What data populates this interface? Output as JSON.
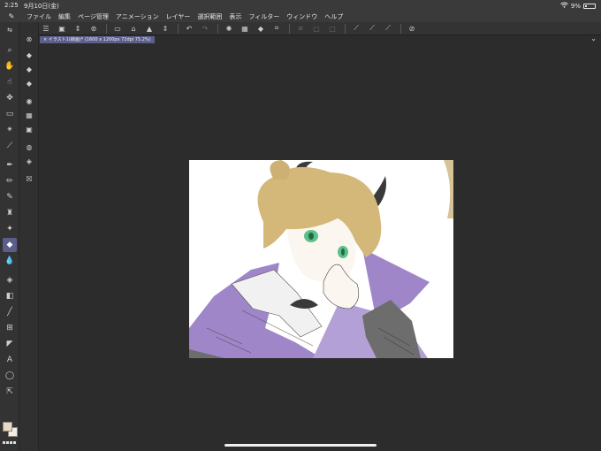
{
  "status_bar": {
    "time": "2:25",
    "date": "9月10日(金)",
    "battery": "9%"
  },
  "menu": {
    "items": [
      "ファイル",
      "編集",
      "ページ管理",
      "アニメーション",
      "レイヤー",
      "選択範囲",
      "表示",
      "フィルター",
      "ウィンドウ",
      "ヘルプ"
    ]
  },
  "document": {
    "tab_title": "× イラスト1(線画)* (1600 x 1200px 72dpi 75.2%)"
  },
  "colors": {
    "main_color": "#e9d9c2",
    "sub_color": "#f4ece2",
    "accent": "#5b5d8a"
  },
  "toolbar_icons": [
    "menu-icon",
    "new-file-icon",
    "open-file-icon",
    "save-icon",
    "undo-icon",
    "redo-icon",
    "clear-icon",
    "fill-icon",
    "transform-icon",
    "deselect-icon",
    "invert-selection-icon",
    "pen-icon",
    "brush-icon",
    "eraser-icon",
    "ruler-icon"
  ]
}
